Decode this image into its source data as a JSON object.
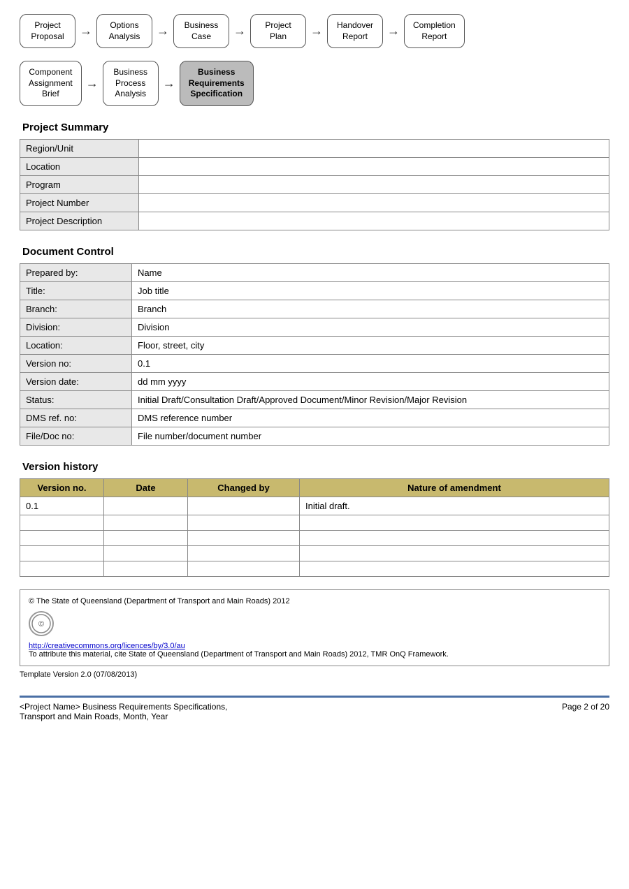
{
  "flow1": {
    "steps": [
      {
        "label": "Project\nProposal",
        "active": false
      },
      {
        "label": "Options\nAnalysis",
        "active": false
      },
      {
        "label": "Business\nCase",
        "active": false
      },
      {
        "label": "Project\nPlan",
        "active": false
      },
      {
        "label": "Handover\nReport",
        "active": false
      },
      {
        "label": "Completion\nReport",
        "active": false
      }
    ]
  },
  "flow2": {
    "steps": [
      {
        "label": "Component\nAssignment\nBrief",
        "active": false
      },
      {
        "label": "Business\nProcess\nAnalysis",
        "active": false
      },
      {
        "label": "Business\nRequirements\nSpecification",
        "active": true
      }
    ]
  },
  "projectSummary": {
    "title": "Project Summary",
    "rows": [
      {
        "label": "Region/Unit",
        "value": ""
      },
      {
        "label": "Location",
        "value": ""
      },
      {
        "label": "Program",
        "value": ""
      },
      {
        "label": "Project Number",
        "value": ""
      },
      {
        "label": "Project Description",
        "value": ""
      }
    ]
  },
  "documentControl": {
    "title": "Document Control",
    "rows": [
      {
        "label": "Prepared by:",
        "value": "Name"
      },
      {
        "label": "Title:",
        "value": "Job title"
      },
      {
        "label": "Branch:",
        "value": "Branch"
      },
      {
        "label": "Division:",
        "value": "Division"
      },
      {
        "label": "Location:",
        "value": "Floor, street, city"
      },
      {
        "label": "Version no:",
        "value": "0.1"
      },
      {
        "label": "Version date:",
        "value": "dd mm yyyy"
      },
      {
        "label": "Status:",
        "value": "Initial Draft/Consultation Draft/Approved Document/Minor Revision/Major Revision"
      },
      {
        "label": "DMS ref. no:",
        "value": "DMS reference number"
      },
      {
        "label": "File/Doc no:",
        "value": "File number/document number"
      }
    ]
  },
  "versionHistory": {
    "title": "Version history",
    "headers": [
      "Version no.",
      "Date",
      "Changed by",
      "Nature of amendment"
    ],
    "rows": [
      {
        "version": "0.1",
        "date": "",
        "changedBy": "",
        "nature": "Initial draft."
      },
      {
        "version": "",
        "date": "",
        "changedBy": "",
        "nature": ""
      },
      {
        "version": "",
        "date": "",
        "changedBy": "",
        "nature": ""
      },
      {
        "version": "",
        "date": "",
        "changedBy": "",
        "nature": ""
      },
      {
        "version": "",
        "date": "",
        "changedBy": "",
        "nature": ""
      }
    ]
  },
  "footer": {
    "copyright": "© The State of Queensland (Department of Transport and Main Roads) 2012",
    "ccLink": "http://creativecommons.org/licences/by/3.0/au",
    "attribution": "To attribute this material, cite State of Queensland (Department of Transport and Main Roads) 2012, TMR OnQ Framework.",
    "templateVersion": "Template Version 2.0 (07/08/2013)"
  },
  "pageFooter": {
    "left1": "<Project Name> Business Requirements Specifications,",
    "left2": "Transport and Main Roads, Month, Year",
    "right": "Page 2 of 20"
  }
}
